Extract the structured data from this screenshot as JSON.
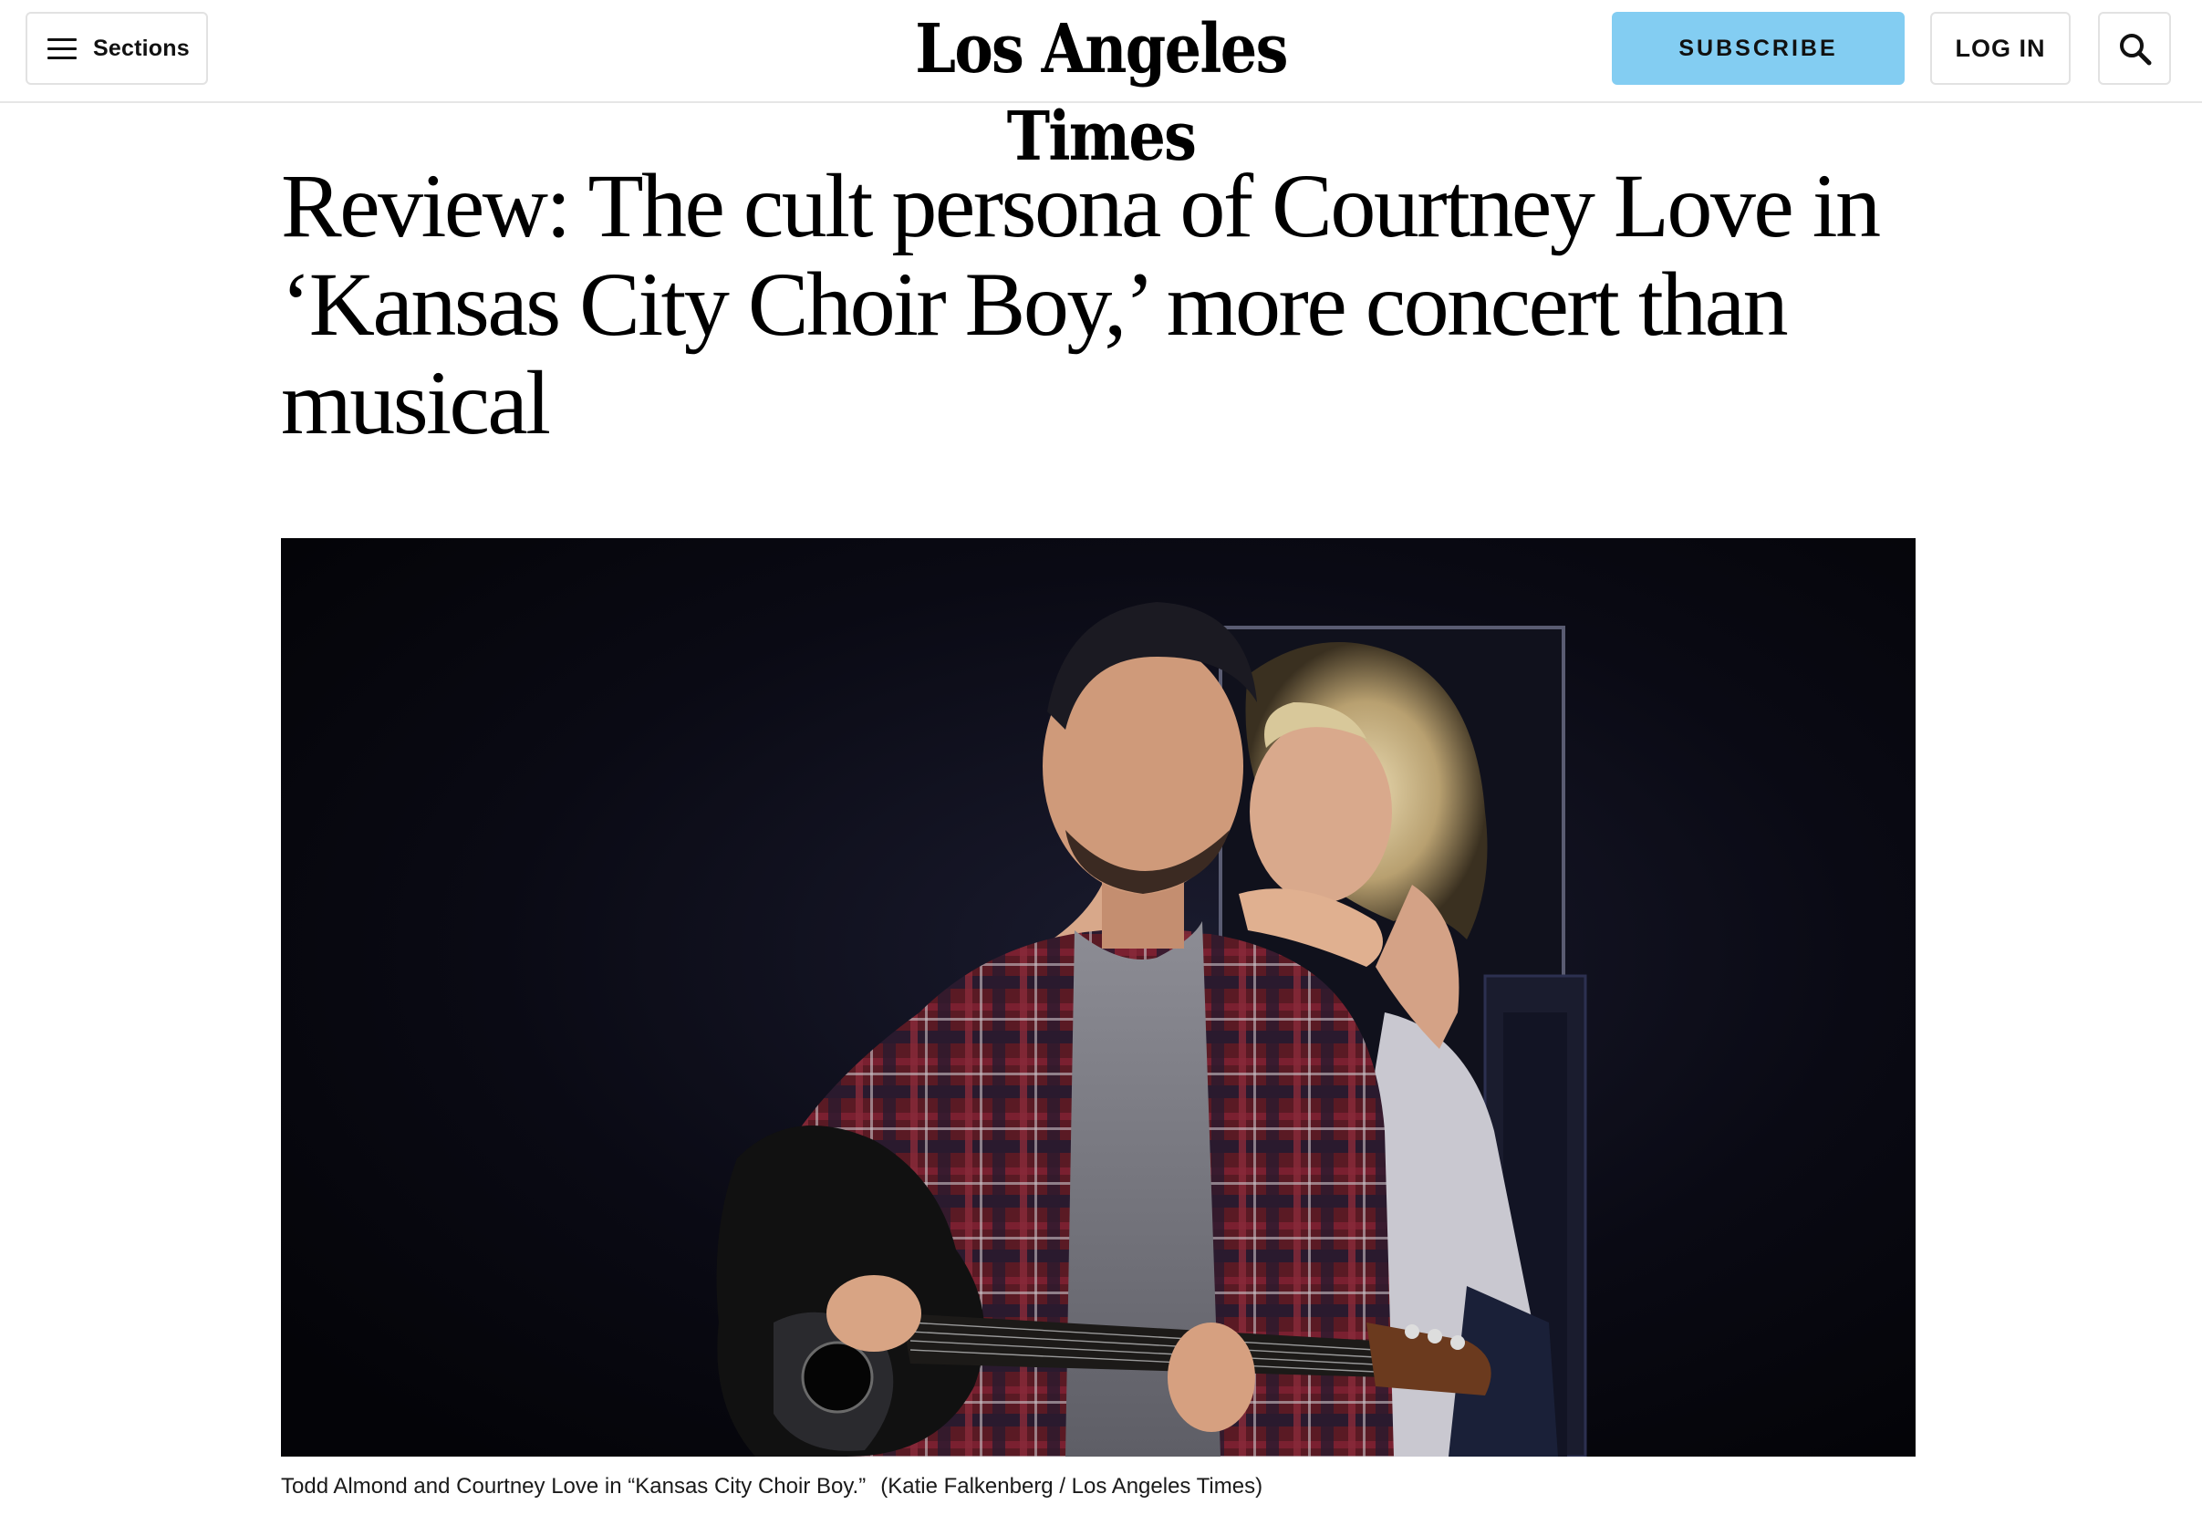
{
  "header": {
    "sections_label": "Sections",
    "logo_text": "Los Angeles Times",
    "subscribe_label": "SUBSCRIBE",
    "login_label": "LOG IN",
    "icons": [
      "hamburger-menu-icon",
      "search-icon"
    ],
    "subscribe_color": "#83cdf2"
  },
  "article": {
    "headline_lines": [
      "Review: The cult persona of Courtney Love in",
      "‘Kansas City Choir Boy,’ more concert than",
      "musical"
    ],
    "caption": "Todd Almond and Courtney Love in “Kansas City Choir Boy.”",
    "credit": "(Katie Falkenberg / Los Angeles Times)"
  }
}
